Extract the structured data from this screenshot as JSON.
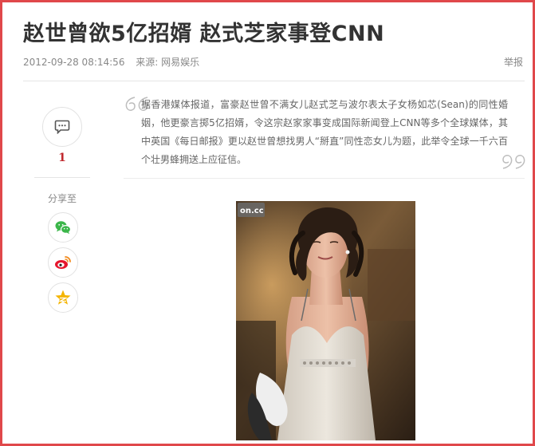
{
  "article": {
    "title": "赵世曾欲5亿招婿 赵式芝家事登CNN",
    "datetime": "2012-09-28 08:14:56",
    "source_label": "来源:",
    "source_name": "网易娱乐",
    "report_label": "举报",
    "summary": "据香港媒体报道，富豪赵世曾不满女儿赵式芝与波尔表太子女杨如芯(Sean)的同性婚姻，他更豪言掷5亿招婿，令这宗赵家家事变成国际新闻登上CNN等多个全球媒体，其中英国《每日邮报》更以赵世曾想找男人“掰直”同性恋女儿为题，此举令全球一千六百个壮男蜂拥送上应征信。",
    "photo_watermark": "on.cc"
  },
  "sidebar": {
    "comment_count": "1",
    "share_label": "分享至",
    "share_items": [
      {
        "name": "wechat",
        "icon": "wechat-icon",
        "color": "#3bb64a"
      },
      {
        "name": "weibo",
        "icon": "weibo-icon",
        "color": "#e6162d"
      },
      {
        "name": "qzone",
        "icon": "qzone-star-icon",
        "color": "#f4b400"
      }
    ]
  },
  "colors": {
    "frame_border": "#e0484a",
    "title": "#333333",
    "meta": "#888888",
    "comment_count": "#c0282d"
  }
}
